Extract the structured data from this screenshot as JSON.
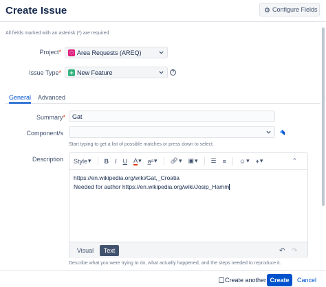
{
  "header": {
    "title": "Create Issue",
    "configure_label": "Configure Fields",
    "configure_icon": "gear-icon"
  },
  "required_note": "All fields marked with an asterisk (*) are required",
  "project": {
    "label": "Project",
    "value": "Area Requests (AREQ)"
  },
  "issue_type": {
    "label": "Issue Type",
    "value": "New Feature"
  },
  "tabs": [
    {
      "label": "General",
      "active": true
    },
    {
      "label": "Advanced",
      "active": false
    }
  ],
  "summary": {
    "label": "Summary",
    "value": "Gat"
  },
  "components": {
    "label": "Component/s",
    "hint": "Start typing to get a list of possible matches or press down to select."
  },
  "description": {
    "label": "Description",
    "toolbar": {
      "style": "Style",
      "bold": "B",
      "italic": "I",
      "underline": "U",
      "color": "A"
    },
    "lines": [
      "https://en.wikipedia.org/wiki/Gat,_Croatia",
      "Needed for author https://en.wikipedia.org/wiki/Josip_Hamm"
    ],
    "mode_visual": "Visual",
    "mode_text": "Text",
    "hint": "Describe what you were trying to do, what actually happened, and the steps needed to reproduce it."
  },
  "footer": {
    "create_another": "Create another",
    "create": "Create",
    "cancel": "Cancel"
  },
  "colors": {
    "primary": "#0052cc",
    "required": "#de350b",
    "project_icon": "#de1c7b",
    "feature_icon": "#36b37e"
  }
}
